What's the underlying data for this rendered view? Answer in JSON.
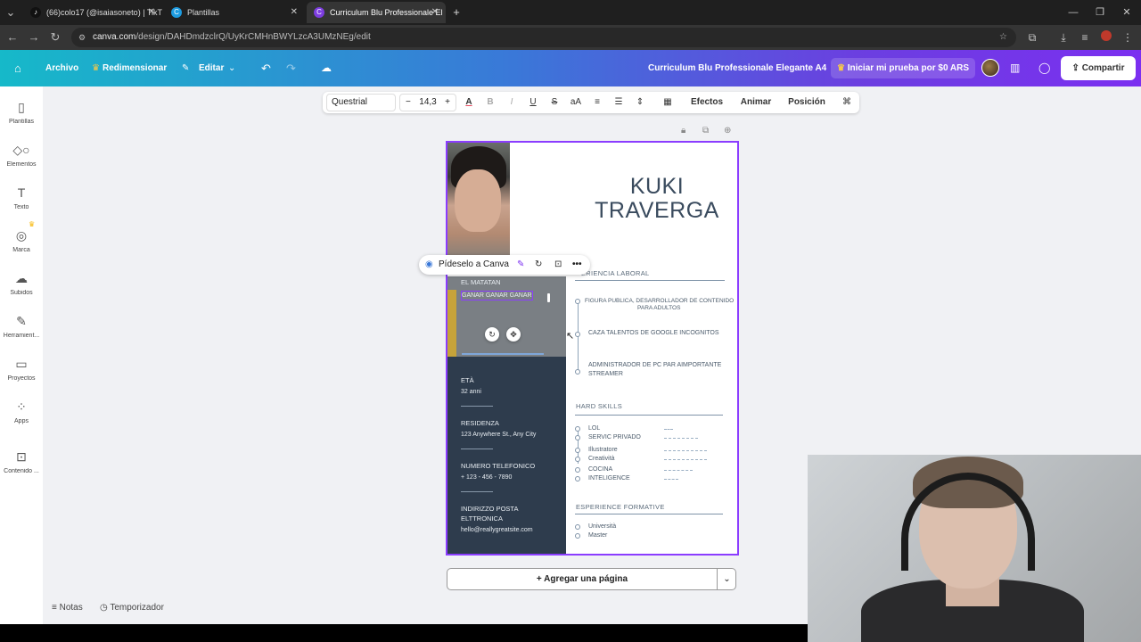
{
  "browser": {
    "tabs": [
      {
        "title": "(66)colo17 (@isaiasoneto) | TikT",
        "icon": "tiktok-icon"
      },
      {
        "title": "Plantillas",
        "icon": "canva-icon"
      },
      {
        "title": "Curriculum Blu Professionale El",
        "icon": "canva-icon"
      }
    ],
    "url_host": "canva.com",
    "url_path": "/design/DAHDmdzclrQ/UyKrCMHnBWYLzcA3UMzNEg/edit"
  },
  "header": {
    "home_icon": "home-icon",
    "archivo": "Archivo",
    "redimensionar": "Redimensionar",
    "editar": "Editar",
    "doc_title": "Curriculum Blu Professionale Elegante A4",
    "trial": "Iniciar mi prueba por $0 ARS",
    "share": "Compartir"
  },
  "sidebar": {
    "items": [
      {
        "label": "Plantillas",
        "icon": "templates-icon"
      },
      {
        "label": "Elementos",
        "icon": "elements-icon"
      },
      {
        "label": "Texto",
        "icon": "text-icon"
      },
      {
        "label": "Marca",
        "icon": "brand-icon"
      },
      {
        "label": "Subidos",
        "icon": "upload-icon"
      },
      {
        "label": "Herramient...",
        "icon": "tools-icon"
      },
      {
        "label": "Proyectos",
        "icon": "folder-icon"
      },
      {
        "label": "Apps",
        "icon": "apps-icon"
      },
      {
        "label": "Contenido ...",
        "icon": "content-icon"
      }
    ]
  },
  "toolbar": {
    "font": "Questrial",
    "size": "14,3",
    "efectos": "Efectos",
    "animar": "Animar",
    "posicion": "Posición"
  },
  "float_menu": {
    "ask": "Pídeselo a Canva"
  },
  "resume": {
    "first_name": "KUKI",
    "last_name": "TRAVERGA",
    "left": {
      "title": "EL MATATAN",
      "subtitle": "GANAR GANAR GANAR",
      "age_label": "ETÀ",
      "age": "32 anni",
      "residence_label": "RESIDENZA",
      "residence": "123 Anywhere St., Any City",
      "phone_label": "NUMERO TELEFONICO",
      "phone": "+ 123 - 456 - 7890",
      "email_label_1": "INDIRIZZO POSTA",
      "email_label_2": "ELTTRONICA",
      "email": "hello@reallygreatsite.com"
    },
    "experience_heading": "ERIENCIA LABORAL",
    "experience": [
      {
        "line1": "FIGURA PUBLICA, DESARROLLADOR DE CONTENIDO",
        "line2": "PARA ADULTOS"
      },
      {
        "line1": "CAZA TALENTOS DE GOOGLE INCOGNITOS",
        "line2": ""
      },
      {
        "line1": "ADMINISTRADOR  DE PC PAR AIMPORTANTE",
        "line2": "STREAMER"
      }
    ],
    "skills_heading": "HARD SKILLS",
    "skills": [
      "LOL",
      "SERVIC PRIVADO",
      "Illustratore",
      "Creatività",
      "COCINA",
      "INTELIGENCE"
    ],
    "skill_levels": [
      0.15,
      0.6,
      0.75,
      0.75,
      0.5,
      0.25
    ],
    "education_heading": "ESPERIENCE FORMATIVE",
    "education": [
      "Università",
      "Master"
    ]
  },
  "canvas": {
    "add_page": "+ Agregar una página"
  },
  "footer": {
    "notes": "Notas",
    "timer": "Temporizador"
  },
  "colors": {
    "accent": "#8b3dff",
    "resume_dark": "#2e3c4d"
  }
}
